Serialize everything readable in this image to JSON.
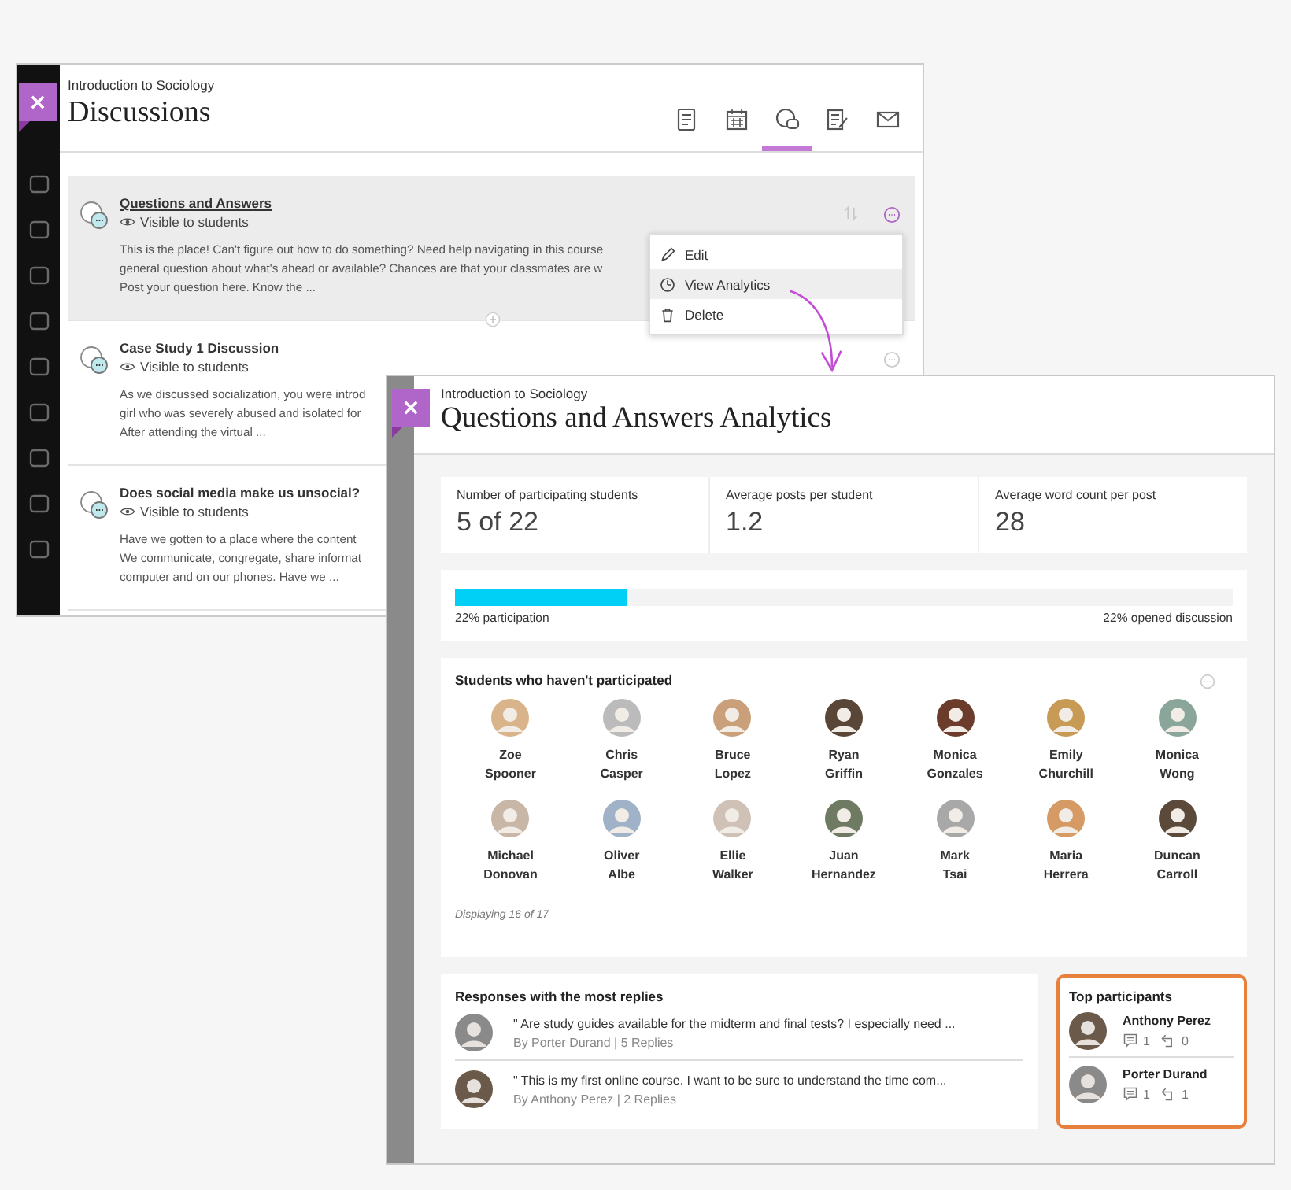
{
  "back_window": {
    "course": "Introduction to Sociology",
    "title": "Discussions",
    "tabs": [
      {
        "selected": false
      },
      {
        "selected": false
      },
      {
        "selected": true
      },
      {
        "selected": false
      },
      {
        "selected": false
      }
    ],
    "discussions": [
      {
        "title": "Questions and Answers",
        "visibility": "Visible to students",
        "highlighted": true,
        "lines": [
          "This is the place! Can't figure out how to do something? Need help navigating in this course",
          "general question about what's ahead or available? Chances are that your classmates are w",
          "Post your question here. Know the ..."
        ]
      },
      {
        "title": "Case Study 1 Discussion",
        "visibility": "Visible to students",
        "highlighted": false,
        "lines": [
          "As we discussed socialization, you were introd",
          "girl who was severely abused and isolated for",
          "After attending the virtual ..."
        ]
      },
      {
        "title": "Does social media make us unsocial?",
        "visibility": "Visible to students",
        "highlighted": false,
        "lines": [
          "Have we gotten to a place where the content",
          "We communicate, congregate, share informat",
          "computer and on our phones. Have we ..."
        ]
      }
    ],
    "menu": [
      {
        "label": "Edit",
        "selected": false
      },
      {
        "label": "View Analytics",
        "selected": true
      },
      {
        "label": "Delete",
        "selected": false
      }
    ]
  },
  "analytics_window": {
    "course": "Introduction to Sociology",
    "title": "Questions and Answers Analytics",
    "stats": [
      {
        "label": "Number of participating students",
        "value": "5 of 22"
      },
      {
        "label": "Average posts per student",
        "value": "1.2"
      },
      {
        "label": "Average word count per post",
        "value": "28"
      }
    ],
    "participation": {
      "level": 0.22,
      "left_label": "22% participation",
      "right_label": "22% opened discussion"
    },
    "non_participants": {
      "title": "Students who haven't participated",
      "footer": "Displaying 16 of 17",
      "students": [
        {
          "first": "Zoe",
          "last": "Spooner"
        },
        {
          "first": "Chris",
          "last": "Casper"
        },
        {
          "first": "Bruce",
          "last": "Lopez"
        },
        {
          "first": "Ryan",
          "last": "Griffin"
        },
        {
          "first": "Monica",
          "last": "Gonzales"
        },
        {
          "first": "Emily",
          "last": "Churchill"
        },
        {
          "first": "Monica",
          "last": "Wong"
        },
        {
          "first": "Michael",
          "last": "Donovan"
        },
        {
          "first": "Oliver",
          "last": "Albe"
        },
        {
          "first": "Ellie",
          "last": "Walker"
        },
        {
          "first": "Juan",
          "last": "Hernandez"
        },
        {
          "first": "Mark",
          "last": "Tsai"
        },
        {
          "first": "Maria",
          "last": "Herrera"
        },
        {
          "first": "Duncan",
          "last": "Carroll"
        }
      ]
    },
    "responses": {
      "title": "Responses with the most replies",
      "items": [
        {
          "text": "\" Are study guides available for the midterm and final tests? I especially need ...",
          "byline": "By Porter Durand | 5 Replies"
        },
        {
          "text": "\" This is my first online course. I want to be sure to understand the time com...",
          "byline": "By Anthony Perez | 2 Replies"
        }
      ]
    },
    "top_participants": {
      "title": "Top participants",
      "people": [
        {
          "name": "Anthony Perez",
          "posts": "1",
          "replies": "0"
        },
        {
          "name": "Porter Durand",
          "posts": "1",
          "replies": "1"
        }
      ]
    }
  }
}
